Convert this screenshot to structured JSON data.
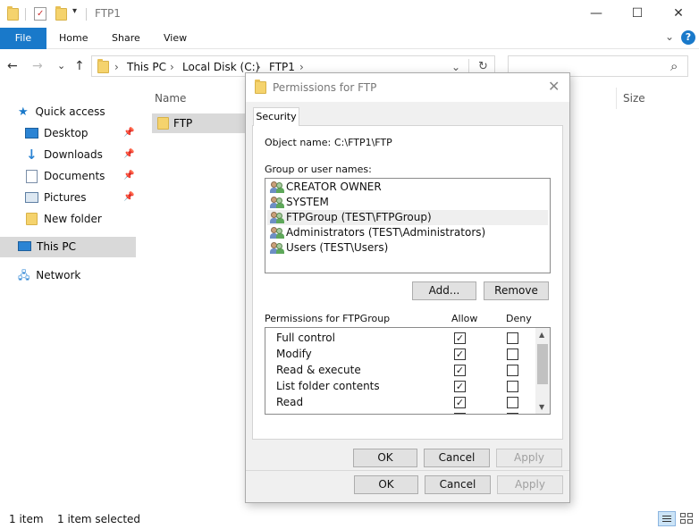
{
  "window": {
    "title": "FTP1",
    "minimize_icon": "—",
    "maximize_icon": "☐",
    "close_icon": "✕"
  },
  "ribbon": {
    "tabs": [
      "File",
      "Home",
      "Share",
      "View"
    ],
    "expand_icon": "⌄",
    "help_icon": "?"
  },
  "address": {
    "back": "←",
    "forward": "→",
    "recent": "⌄",
    "up": "↑",
    "crumbs": [
      "This PC",
      "Local Disk (C:)",
      "FTP1"
    ],
    "separator": "›",
    "dropdown": "⌄",
    "refresh": "↻",
    "search_icon": "⌕"
  },
  "sidebar": {
    "quick_access": "Quick access",
    "items": [
      {
        "label": "Desktop",
        "pinned": true
      },
      {
        "label": "Downloads",
        "pinned": true
      },
      {
        "label": "Documents",
        "pinned": true
      },
      {
        "label": "Pictures",
        "pinned": true
      },
      {
        "label": "New folder",
        "pinned": false
      }
    ],
    "this_pc": "This PC",
    "network": "Network"
  },
  "file_list": {
    "columns": {
      "name": "Name",
      "size": "Size"
    },
    "rows": [
      {
        "name": "FTP"
      }
    ]
  },
  "status_bar": {
    "count": "1 item",
    "selected": "1 item selected"
  },
  "dialog": {
    "title": "Permissions for FTP",
    "close_icon": "✕",
    "tab": "Security",
    "object_name_label": "Object name:",
    "object_name_value": "C:\\FTP1\\FTP",
    "group_label": "Group or user names:",
    "users": [
      {
        "label": "CREATOR OWNER",
        "selected": false
      },
      {
        "label": "SYSTEM",
        "selected": false
      },
      {
        "label": "FTPGroup (TEST\\FTPGroup)",
        "selected": true
      },
      {
        "label": "Administrators (TEST\\Administrators)",
        "selected": false
      },
      {
        "label": "Users (TEST\\Users)",
        "selected": false
      }
    ],
    "add_button": "Add...",
    "remove_button": "Remove",
    "permissions_label": "Permissions for FTPGroup",
    "allow_header": "Allow",
    "deny_header": "Deny",
    "permissions": [
      {
        "name": "Full control",
        "allow": true,
        "deny": false
      },
      {
        "name": "Modify",
        "allow": true,
        "deny": false
      },
      {
        "name": "Read & execute",
        "allow": true,
        "deny": false
      },
      {
        "name": "List folder contents",
        "allow": true,
        "deny": false
      },
      {
        "name": "Read",
        "allow": true,
        "deny": false
      }
    ],
    "scroll_up": "▲",
    "scroll_down": "▼",
    "ok": "OK",
    "cancel": "Cancel",
    "apply": "Apply"
  },
  "colors": {
    "accent": "#1979ca",
    "folder": "#f5d36d",
    "selection": "#d9d9d9"
  }
}
